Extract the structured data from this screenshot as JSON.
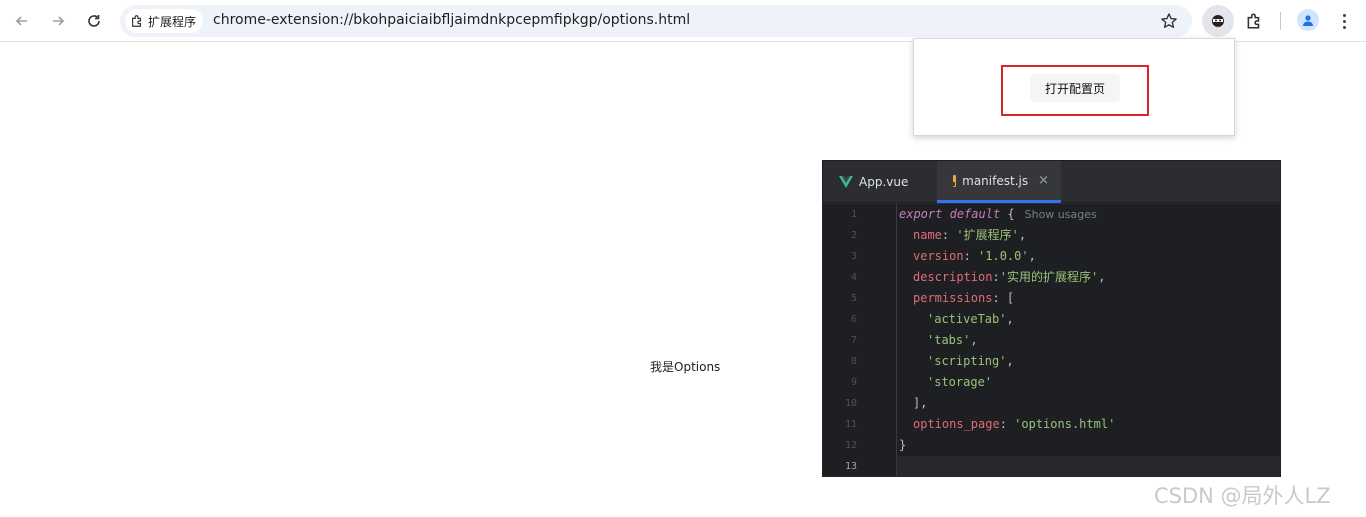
{
  "browser": {
    "chip_label": "扩展程序",
    "url": "chrome-extension://bkohpaiciaibfljaimdnkpcepmfipkgp/options.html"
  },
  "popup": {
    "button_label": "打开配置页",
    "highlight_color": "#d9262c"
  },
  "page": {
    "text": "我是Options"
  },
  "ide": {
    "tabs": [
      {
        "label": "App.vue",
        "icon": "vue-icon",
        "active": false
      },
      {
        "label": "manifest.js",
        "icon": "js-file-icon",
        "active": true,
        "close": "×"
      }
    ],
    "inlay_hint": "Show usages",
    "line_numbers": [
      "1",
      "2",
      "3",
      "4",
      "5",
      "6",
      "7",
      "8",
      "9",
      "10",
      "11",
      "12",
      "13"
    ],
    "code": {
      "l1_export": "export",
      "l1_default": "default",
      "l1_brace": " {",
      "l2_key": "name",
      "l2_val": "'扩展程序'",
      "l3_key": "version",
      "l3_val": "'1.0.0'",
      "l4_key": "description",
      "l4_val": "'实用的扩展程序'",
      "l5_key": "permissions",
      "l5_rest": ": [",
      "l6": "'activeTab'",
      "l7": "'tabs'",
      "l8": "'scripting'",
      "l9": "'storage'",
      "l10": "],",
      "l11_key": "options_page",
      "l11_val": "'options.html'",
      "l12": "}"
    }
  },
  "watermark": "CSDN @局外人LZ"
}
